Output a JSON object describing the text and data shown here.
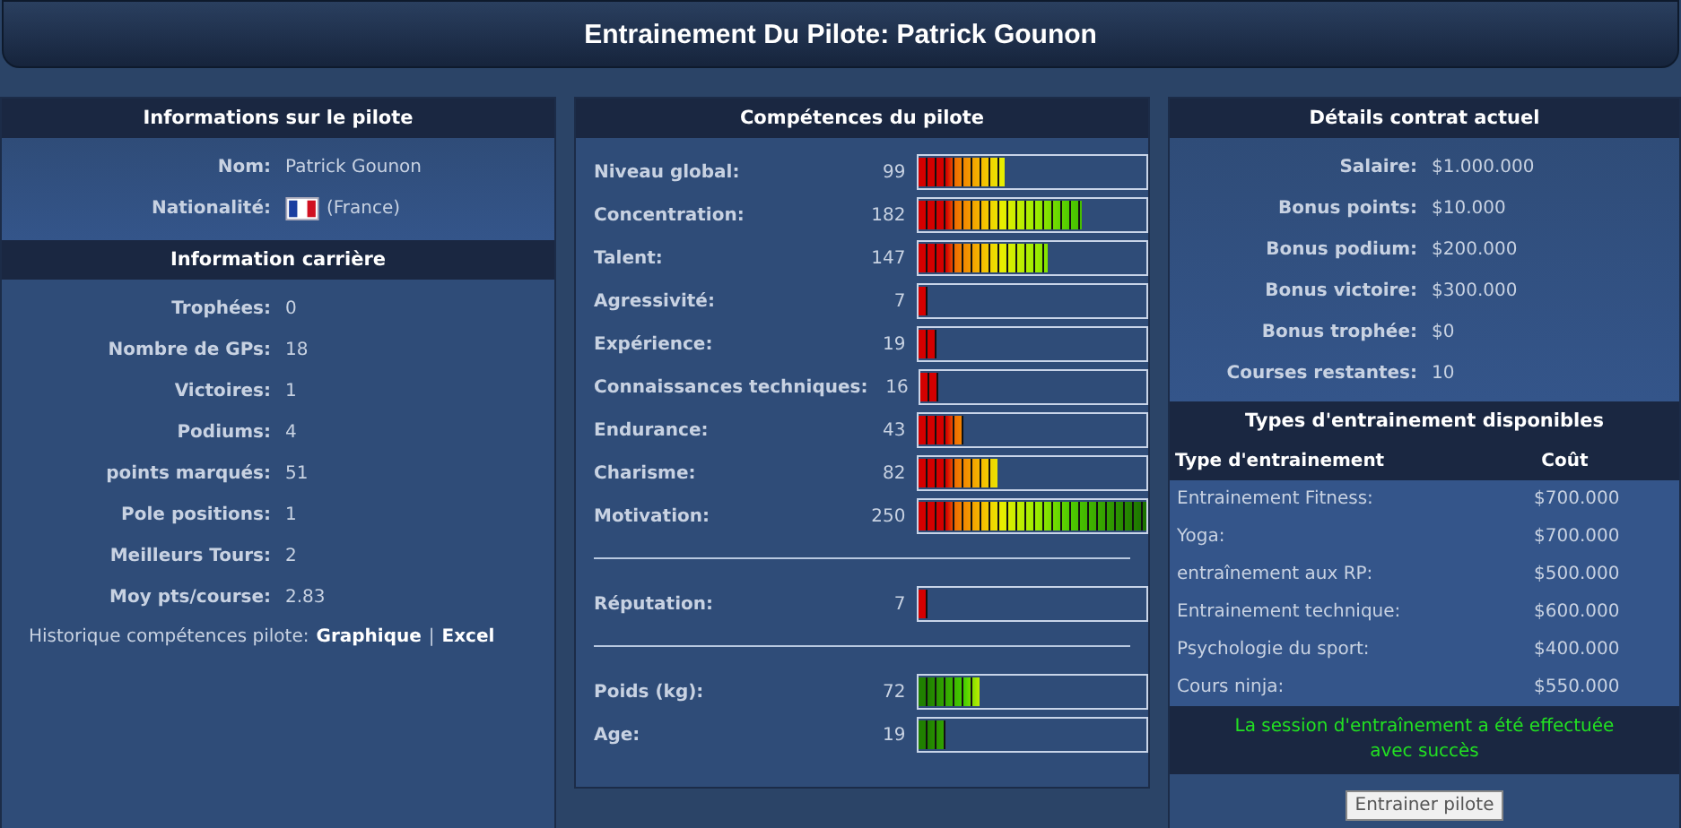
{
  "title": "Entrainement Du Pilote: Patrick Gounon",
  "driver_info": {
    "header": "Informations sur le pilote",
    "rows": [
      {
        "label": "Nom:",
        "value": "Patrick Gounon"
      },
      {
        "label": "Nationalité:",
        "value": "(France)",
        "kind": "flag"
      }
    ]
  },
  "career": {
    "header": "Information carrière",
    "rows": [
      {
        "label": "Trophées:",
        "value": "0"
      },
      {
        "label": "Nombre de GPs:",
        "value": "18"
      },
      {
        "label": "Victoires:",
        "value": "1"
      },
      {
        "label": "Podiums:",
        "value": "4"
      },
      {
        "label": "points marqués:",
        "value": "51"
      },
      {
        "label": "Pole positions:",
        "value": "1"
      },
      {
        "label": "Meilleurs Tours:",
        "value": "2"
      },
      {
        "label": "Moy pts/course:",
        "value": "2.83"
      }
    ],
    "history": {
      "label": "Historique compétences pilote:",
      "links": [
        "Graphique",
        "Excel"
      ],
      "separator": "|"
    }
  },
  "skills": {
    "header": "Compétences du pilote",
    "groups": [
      [
        {
          "label": "Niveau global:",
          "value": "99",
          "level": 0.38,
          "kind": "skill"
        },
        {
          "label": "Concentration:",
          "value": "182",
          "level": 0.72,
          "kind": "skill"
        },
        {
          "label": "Talent:",
          "value": "147",
          "level": 0.57,
          "kind": "skill"
        },
        {
          "label": "Agressivité:",
          "value": "7",
          "level": 0.04,
          "kind": "skill"
        },
        {
          "label": "Expérience:",
          "value": "19",
          "level": 0.08,
          "kind": "skill"
        },
        {
          "label": "Connaissances techniques:",
          "value": "16",
          "level": 0.08,
          "kind": "skill"
        },
        {
          "label": "Endurance:",
          "value": "43",
          "level": 0.2,
          "kind": "skill"
        },
        {
          "label": "Charisme:",
          "value": "82",
          "level": 0.35,
          "kind": "skill"
        },
        {
          "label": "Motivation:",
          "value": "250",
          "level": 1.0,
          "kind": "skill"
        }
      ],
      [
        {
          "label": "Réputation:",
          "value": "7",
          "level": 0.04,
          "kind": "skill"
        }
      ],
      [
        {
          "label": "Poids (kg):",
          "value": "72",
          "level": 0.27,
          "kind": "body"
        },
        {
          "label": "Age:",
          "value": "19",
          "level": 0.12,
          "kind": "body"
        }
      ]
    ]
  },
  "contract": {
    "header": "Détails contrat actuel",
    "rows": [
      {
        "label": "Salaire:",
        "value": "$1.000.000"
      },
      {
        "label": "Bonus points:",
        "value": "$10.000"
      },
      {
        "label": "Bonus podium:",
        "value": "$200.000"
      },
      {
        "label": "Bonus victoire:",
        "value": "$300.000"
      },
      {
        "label": "Bonus trophée:",
        "value": "$0"
      },
      {
        "label": "Courses restantes:",
        "value": "10"
      }
    ]
  },
  "training": {
    "header": "Types d'entrainement disponibles",
    "columns": [
      "Type d'entrainement",
      "Coût"
    ],
    "rows": [
      {
        "type": "Entrainement Fitness:",
        "cost": "$700.000"
      },
      {
        "type": "Yoga:",
        "cost": "$700.000"
      },
      {
        "type": "entraînement aux RP:",
        "cost": "$500.000"
      },
      {
        "type": "Entrainement technique:",
        "cost": "$600.000"
      },
      {
        "type": "Psychologie du sport:",
        "cost": "$400.000"
      },
      {
        "type": "Cours ninja:",
        "cost": "$550.000"
      }
    ],
    "message": "La session d'entraînement a été effectuée avec succès",
    "button": "Entrainer pilote"
  }
}
